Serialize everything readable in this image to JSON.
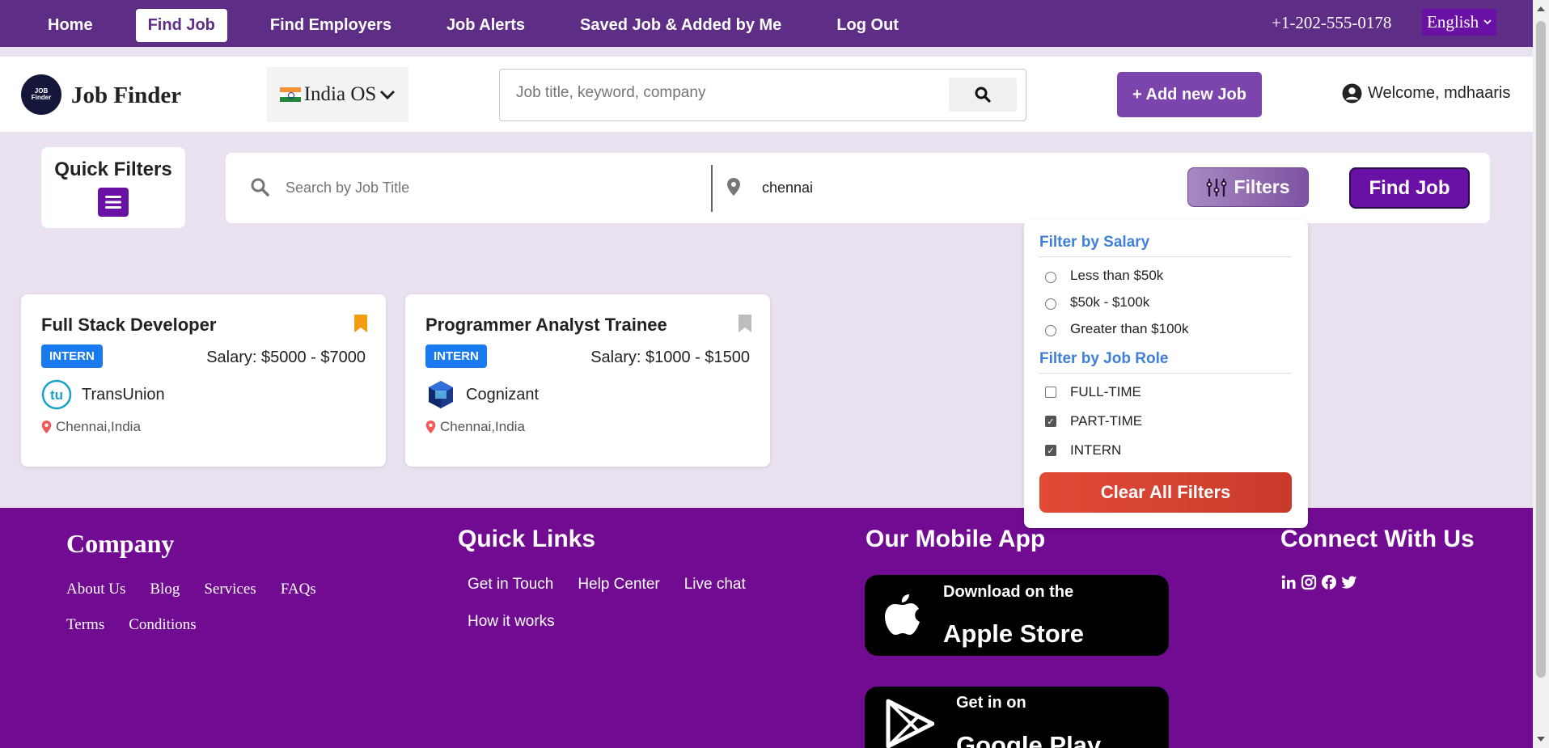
{
  "topnav": {
    "items": [
      {
        "label": "Home",
        "active": false
      },
      {
        "label": "Find Job",
        "active": true
      },
      {
        "label": "Find Employers",
        "active": false
      },
      {
        "label": "Job Alerts",
        "active": false
      },
      {
        "label": "Saved Job & Added by Me",
        "active": false
      },
      {
        "label": "Log Out",
        "active": false
      }
    ],
    "phone": "+1-202-555-0178",
    "language": "English"
  },
  "header": {
    "logo_mark": "JOB Finder",
    "brand": "Job Finder",
    "country": "India OS",
    "search_placeholder": "Job title, keyword, company",
    "add_job_label": "+ Add new Job",
    "welcome": "Welcome, mdhaaris"
  },
  "quick_filters": {
    "label": "Quick Filters",
    "icon": "menu-icon"
  },
  "search": {
    "job_title_placeholder": "Search by Job Title",
    "location_value": "chennai",
    "filters_label": "Filters",
    "find_job_label": "Find Job"
  },
  "filter_panel": {
    "salary_heading": "Filter by Salary",
    "salary_options": [
      {
        "label": "Less than $50k",
        "selected": false
      },
      {
        "label": "$50k - $100k",
        "selected": false
      },
      {
        "label": "Greater than $100k",
        "selected": false
      }
    ],
    "role_heading": "Filter by Job Role",
    "role_options": [
      {
        "label": "FULL-TIME",
        "checked": false
      },
      {
        "label": "PART-TIME",
        "checked": true
      },
      {
        "label": "INTERN",
        "checked": true
      }
    ],
    "clear_label": "Clear All Filters"
  },
  "jobs": [
    {
      "title": "Full Stack Developer",
      "type": "INTERN",
      "salary": "Salary: $5000 - $7000",
      "company": "TransUnion",
      "location": "Chennai,India",
      "bookmarked": true,
      "bookmark_color": "#f29c11"
    },
    {
      "title": "Programmer Analyst Trainee",
      "type": "INTERN",
      "salary": "Salary: $1000 - $1500",
      "company": "Cognizant",
      "location": "Chennai,India",
      "bookmarked": false,
      "bookmark_color": "#bdbdbd"
    }
  ],
  "footer": {
    "company_heading": "Company",
    "company_links": [
      "About Us",
      "Blog",
      "Services",
      "FAQs",
      "Terms",
      "Conditions"
    ],
    "quick_heading": "Quick Links",
    "quick_links": [
      "Get in Touch",
      "Help Center",
      "Live chat",
      "How it works"
    ],
    "app_heading": "Our Mobile App",
    "apple": {
      "small": "Download on the",
      "big": "Apple Store"
    },
    "google": {
      "small": "Get in on",
      "big": "Google Play"
    },
    "connect_heading": "Connect With Us",
    "social_icons": [
      "linkedin-icon",
      "instagram-icon",
      "facebook-icon",
      "twitter-icon"
    ]
  },
  "colors": {
    "nav_bg": "#5e2d85",
    "page_bg": "#e9e1ef",
    "accent_purple": "#6a11a5",
    "footer_bg": "#700b92",
    "badge_blue": "#1a7bf0",
    "filter_heading_blue": "#3f7fd6",
    "clear_red": "#e24a37"
  }
}
